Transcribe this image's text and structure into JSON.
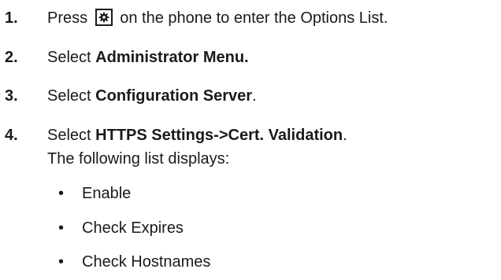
{
  "steps": [
    {
      "number": "1.",
      "text_before_icon": "Press",
      "icon": "gear-icon",
      "text_after_icon": "on the phone to enter the Options List."
    },
    {
      "number": "2.",
      "prefix": "Select ",
      "bold": "Administrator Menu.",
      "suffix": ""
    },
    {
      "number": "3.",
      "prefix": "Select ",
      "bold": "Configuration Server",
      "suffix": "."
    },
    {
      "number": "4.",
      "prefix": "Select ",
      "bold": "HTTPS Settings->Cert. Validation",
      "suffix": ".",
      "continuation": "The following list displays:"
    }
  ],
  "bullet_char": "•",
  "list_items": [
    "Enable",
    "Check Expires",
    "Check Hostnames"
  ]
}
